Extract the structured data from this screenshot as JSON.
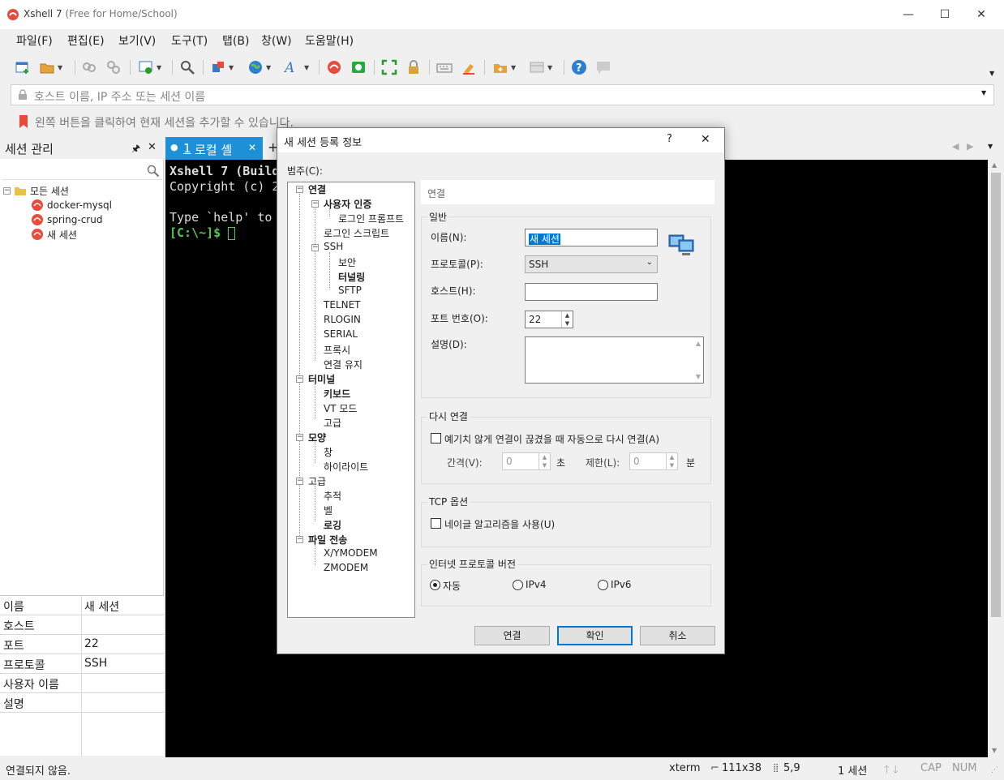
{
  "window": {
    "app_name": "Xshell 7",
    "edition": "(Free for Home/School)",
    "controls": {
      "minimize": "—",
      "maximize": "☐",
      "close": "✕"
    }
  },
  "menu": [
    "파일(F)",
    "편집(E)",
    "보기(V)",
    "도구(T)",
    "탭(B)",
    "창(W)",
    "도움말(H)"
  ],
  "address_bar": {
    "placeholder": "호스트 이름, IP 주소 또는 세션 이름"
  },
  "hint_bar": {
    "text": "왼쪽 버튼을 클릭하여 현재 세션을 추가할 수 있습니다."
  },
  "session_panel": {
    "title": "세션 관리",
    "root": "모든 세션",
    "sessions": [
      "docker-mysql",
      "spring-crud",
      "새 세션"
    ]
  },
  "properties": [
    {
      "key": "이름",
      "value": "새 세션"
    },
    {
      "key": "호스트",
      "value": ""
    },
    {
      "key": "포트",
      "value": "22"
    },
    {
      "key": "프로토콜",
      "value": "SSH"
    },
    {
      "key": "사용자 이름",
      "value": ""
    },
    {
      "key": "설명",
      "value": ""
    }
  ],
  "tab": {
    "index": "1",
    "label": "로컬 셸",
    "add": "+"
  },
  "terminal": {
    "line1": "Xshell 7 (Build",
    "line2": "Copyright (c) 2",
    "line3": "Type `help' to",
    "prompt": "[C:\\~]$ "
  },
  "status": {
    "connection": "연결되지 않음.",
    "terminal_type": "xterm",
    "size": "111x38",
    "cursor": "5,9",
    "sessions": "1 세션",
    "caps": "CAP",
    "num": "NUM"
  },
  "dialog": {
    "title": "새 세션 등록 정보",
    "help": "?",
    "close": "✕",
    "category_label": "범주(C):",
    "tree": {
      "connection": "연결",
      "user_auth": "사용자 인증",
      "login_prompt": "로그인 프롬프트",
      "login_script": "로그인 스크립트",
      "ssh": "SSH",
      "security": "보안",
      "tunneling": "터널링",
      "sftp": "SFTP",
      "telnet": "TELNET",
      "rlogin": "RLOGIN",
      "serial": "SERIAL",
      "proxy": "프록시",
      "keepalive": "연결 유지",
      "terminal": "터미널",
      "keyboard": "키보드",
      "vt_mode": "VT 모드",
      "advanced_t": "고급",
      "appearance": "모양",
      "window": "창",
      "highlight": "하이라이트",
      "advanced": "고급",
      "trace": "추적",
      "bell": "벨",
      "logging": "로깅",
      "file_transfer": "파일 전송",
      "xymodem": "X/YMODEM",
      "zmodem": "ZMODEM"
    },
    "panel_title": "연결",
    "general": {
      "legend": "일반",
      "name_label": "이름(N):",
      "name_value": "새 세션",
      "protocol_label": "프로토콜(P):",
      "protocol_value": "SSH",
      "host_label": "호스트(H):",
      "host_value": "",
      "port_label": "포트 번호(O):",
      "port_value": "22",
      "desc_label": "설명(D):",
      "desc_value": ""
    },
    "reconnect": {
      "legend": "다시 연결",
      "checkbox": "예기치 않게 연결이 끊겼을 때 자동으로 다시 연결(A)",
      "interval_label": "간격(V):",
      "interval_value": "0",
      "interval_unit": "초",
      "limit_label": "제한(L):",
      "limit_value": "0",
      "limit_unit": "분"
    },
    "tcp": {
      "legend": "TCP 옵션",
      "nagle": "네이글 알고리즘을 사용(U)"
    },
    "ipver": {
      "legend": "인터넷 프로토콜 버전",
      "auto": "자동",
      "ipv4": "IPv4",
      "ipv6": "IPv6",
      "selected": "자동"
    },
    "buttons": {
      "connect": "연결",
      "ok": "확인",
      "cancel": "취소"
    }
  }
}
